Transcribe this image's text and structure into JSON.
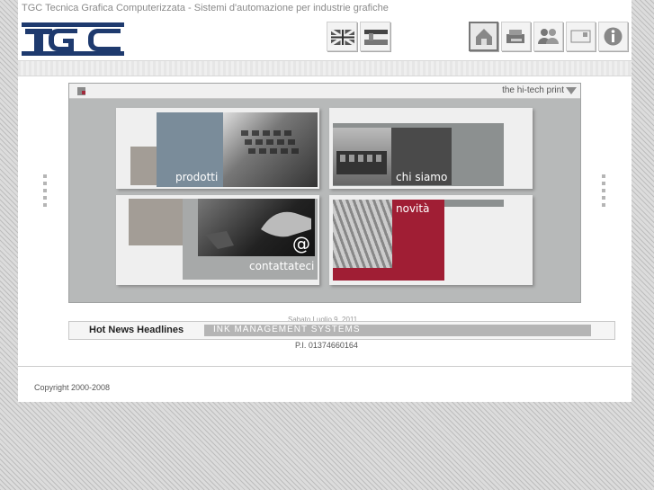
{
  "header": {
    "tagline": "TGC Tecnica Grafica Computerizzata - Sistemi d'automazione per industrie grafiche",
    "logo_text": "TGC"
  },
  "languages": [
    {
      "name": "english-flag"
    },
    {
      "name": "italian-flag"
    }
  ],
  "nav_icons": [
    "home-icon",
    "products-icon",
    "people-icon",
    "mail-icon",
    "info-icon"
  ],
  "panel": {
    "slogan": "the hi-tech print"
  },
  "tiles": {
    "prodotti": "prodotti",
    "chi_siamo": "chi siamo",
    "contattateci": "contattateci",
    "novita": "novità",
    "at_symbol": "@"
  },
  "news": {
    "label": "Hot News Headlines",
    "ticker": "INK MANAGEMENT SYSTEMS"
  },
  "footer": {
    "date": "Sabato Luglio 9, 2011",
    "vat": "P.I. 01374660164",
    "copyright": "Copyright 2000-2008"
  },
  "colors": {
    "accent": "#a01e34",
    "tile_blue": "#7a8c9a",
    "tile_taupe": "#a39d96",
    "panel_grey": "#b7b9b9"
  }
}
